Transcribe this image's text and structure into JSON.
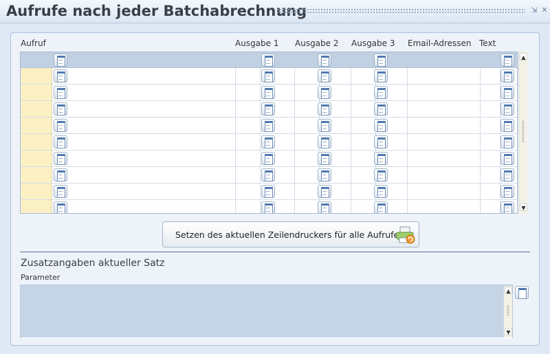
{
  "window": {
    "title": "Aufrufe nach jeder Batchabrechnung",
    "minimize_icon": "restore-icon",
    "close_icon": "close-icon"
  },
  "grid": {
    "columns": [
      "Aufruf",
      "Ausgabe 1",
      "Ausgabe 2",
      "Ausgabe 3",
      "Email-Adressen",
      "Text"
    ],
    "rows": [
      {
        "aufruf": "",
        "ausgabe1": "",
        "ausgabe2": "",
        "ausgabe3": "",
        "email": "",
        "text": ""
      },
      {
        "aufruf": "",
        "ausgabe1": "",
        "ausgabe2": "",
        "ausgabe3": "",
        "email": "",
        "text": ""
      },
      {
        "aufruf": "",
        "ausgabe1": "",
        "ausgabe2": "",
        "ausgabe3": "",
        "email": "",
        "text": ""
      },
      {
        "aufruf": "",
        "ausgabe1": "",
        "ausgabe2": "",
        "ausgabe3": "",
        "email": "",
        "text": ""
      },
      {
        "aufruf": "",
        "ausgabe1": "",
        "ausgabe2": "",
        "ausgabe3": "",
        "email": "",
        "text": ""
      },
      {
        "aufruf": "",
        "ausgabe1": "",
        "ausgabe2": "",
        "ausgabe3": "",
        "email": "",
        "text": ""
      },
      {
        "aufruf": "",
        "ausgabe1": "",
        "ausgabe2": "",
        "ausgabe3": "",
        "email": "",
        "text": ""
      },
      {
        "aufruf": "",
        "ausgabe1": "",
        "ausgabe2": "",
        "ausgabe3": "",
        "email": "",
        "text": ""
      },
      {
        "aufruf": "",
        "ausgabe1": "",
        "ausgabe2": "",
        "ausgabe3": "",
        "email": "",
        "text": ""
      }
    ],
    "cell_button_icon": "lookup-document-icon"
  },
  "actions": {
    "set_printer_label": "Setzen des aktuellen Zeilendruckers für alle Aufrufe",
    "set_printer_icon": "printer-icon"
  },
  "details": {
    "section_title": "Zusatzangaben aktueller Satz",
    "parameter_label": "Parameter",
    "parameter_value": ""
  },
  "colors": {
    "background": "#dfe8f4",
    "header_row": "#c1d1e3",
    "first_column": "#fbf0c4",
    "textarea": "#c5d5e6"
  }
}
